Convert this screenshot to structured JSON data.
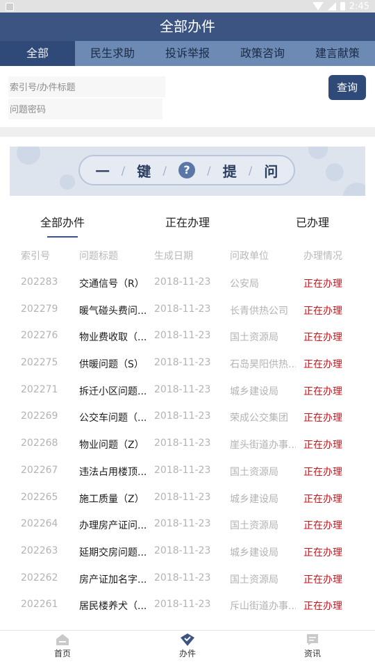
{
  "status": {
    "time": "2:45"
  },
  "title": "全部办件",
  "categories": [
    {
      "label": "全部",
      "active": true
    },
    {
      "label": "民生求助",
      "active": false
    },
    {
      "label": "投诉举报",
      "active": false
    },
    {
      "label": "政策咨询",
      "active": false
    },
    {
      "label": "建言献策",
      "active": false
    }
  ],
  "search": {
    "index_placeholder": "索引号/办件标题",
    "password_placeholder": "问题密码",
    "button_label": "查询"
  },
  "banner": {
    "chars": [
      "一",
      "键",
      "?",
      "提",
      "问"
    ]
  },
  "subtabs": {
    "all": "全部办件",
    "processing": "正在办理",
    "done": "已办理"
  },
  "table": {
    "headers": [
      "索引号",
      "问题标题",
      "生成日期",
      "问政单位",
      "办理情况"
    ],
    "rows": [
      [
        "202283",
        "交通信号（R）",
        "2018-11-23",
        "公安局",
        "正在办理"
      ],
      [
        "202279",
        "暖气碰头费问...",
        "2018-11-23",
        "长青供热公司",
        "正在办理"
      ],
      [
        "202276",
        "物业费收取（...",
        "2018-11-23",
        "国土资源局",
        "正在办理"
      ],
      [
        "202275",
        "供暖问题（S）",
        "2018-11-23",
        "石岛昊阳供热...",
        "正在办理"
      ],
      [
        "202271",
        "拆迁小区问题...",
        "2018-11-23",
        "城乡建设局",
        "正在办理"
      ],
      [
        "202269",
        "公交车问题（...",
        "2018-11-23",
        "荣成公交集团",
        "正在办理"
      ],
      [
        "202268",
        "物业问题（Z）",
        "2018-11-23",
        "崖头街道办事...",
        "正在办理"
      ],
      [
        "202267",
        "违法占用楼顶...",
        "2018-11-23",
        "国土资源局",
        "正在办理"
      ],
      [
        "202265",
        "施工质量（Z）",
        "2018-11-23",
        "城乡建设局",
        "正在办理"
      ],
      [
        "202264",
        "办理房产证问...",
        "2018-11-23",
        "国土资源局",
        "正在办理"
      ],
      [
        "202263",
        "延期交房问题...",
        "2018-11-23",
        "城乡建设局",
        "正在办理"
      ],
      [
        "202262",
        "房产证加名字...",
        "2018-11-23",
        "国土资源局",
        "正在办理"
      ],
      [
        "202261",
        "居民楼养犬（...",
        "2018-11-23",
        "斥山街道办事...",
        "正在办理"
      ]
    ]
  },
  "nav": {
    "home": "首页",
    "cases": "办件",
    "news": "资讯"
  },
  "colors": {
    "primary": "#3b5481",
    "tab_bar": "#6d8ab4",
    "status_red": "#c8161d"
  }
}
